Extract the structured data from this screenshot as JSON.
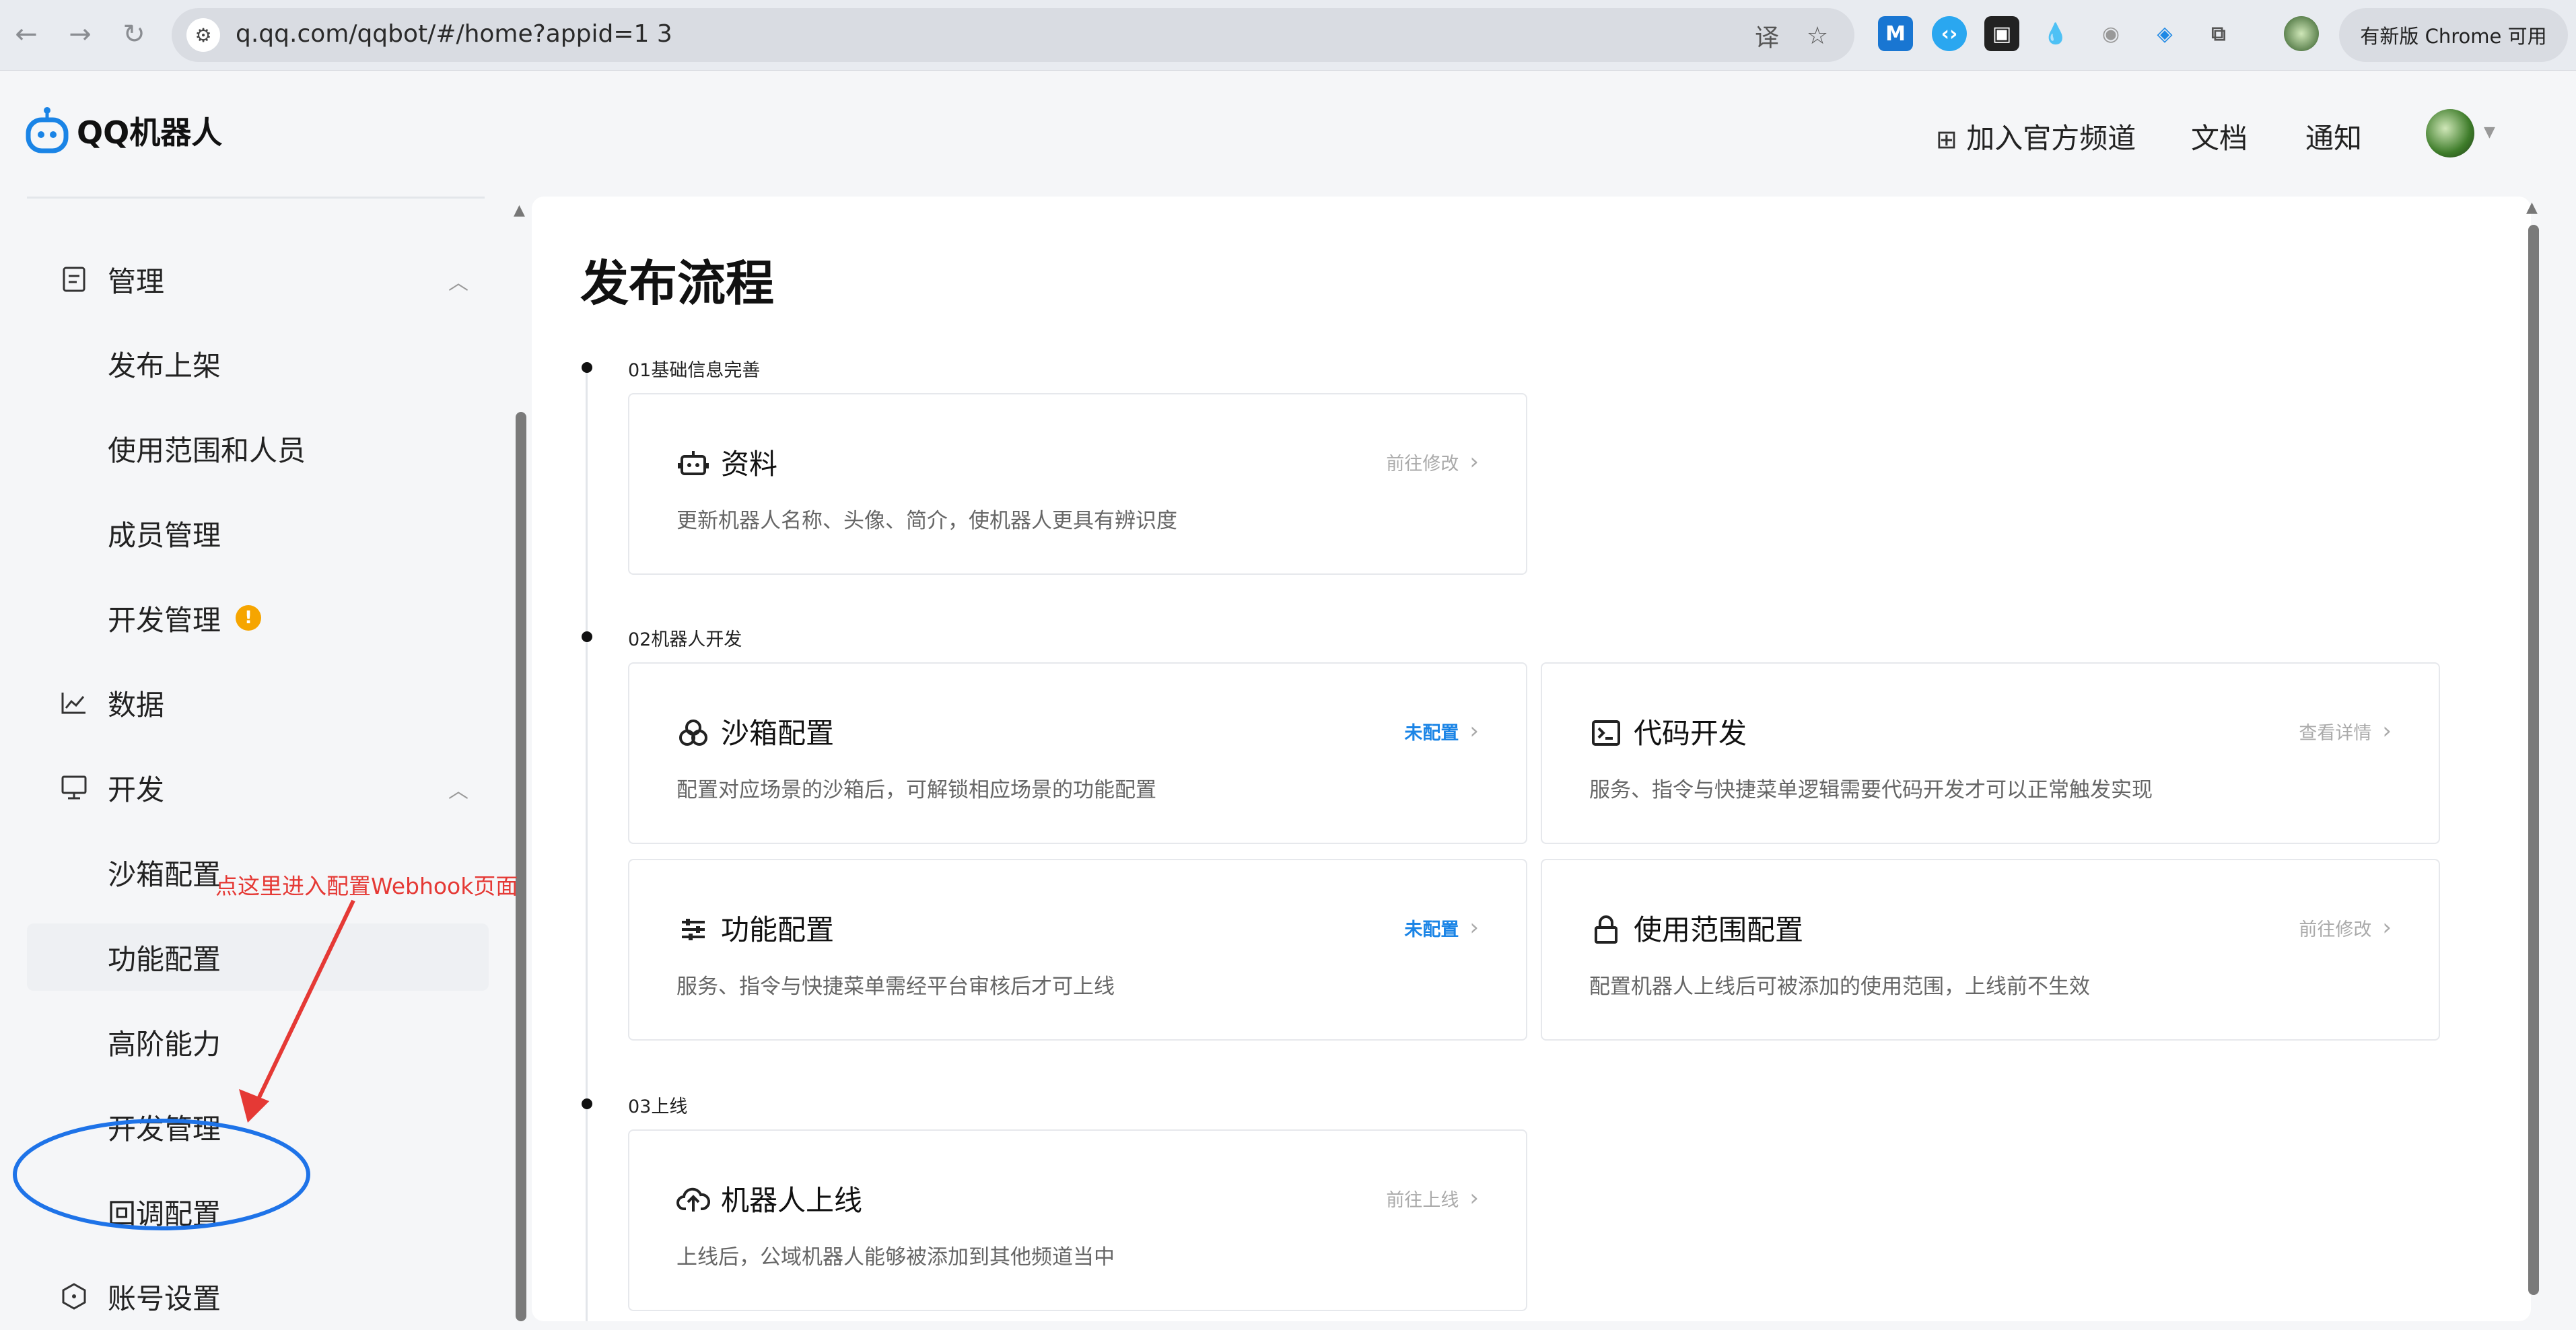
{
  "browser": {
    "url": "q.qq.com/qqbot/#/home?appid=1        3",
    "update_label": "有新版 Chrome 可用",
    "back_icon": "←",
    "forward_icon": "→",
    "reload_icon": "↻"
  },
  "header": {
    "logo_text": "QQ机器人",
    "links": [
      "加入官方频道",
      "文档",
      "通知"
    ]
  },
  "sidebar": {
    "items": [
      {
        "label": "管理",
        "type": "top",
        "icon": "document-icon",
        "expanded": true
      },
      {
        "label": "发布上架",
        "type": "sub"
      },
      {
        "label": "使用范围和人员",
        "type": "sub"
      },
      {
        "label": "成员管理",
        "type": "sub"
      },
      {
        "label": "开发管理",
        "type": "sub",
        "badge": "!"
      },
      {
        "label": "数据",
        "type": "top",
        "icon": "line-chart-icon"
      },
      {
        "label": "开发",
        "type": "top",
        "icon": "monitor-icon",
        "expanded": true
      },
      {
        "label": "沙箱配置",
        "type": "sub"
      },
      {
        "label": "功能配置",
        "type": "sub",
        "active": true
      },
      {
        "label": "高阶能力",
        "type": "sub"
      },
      {
        "label": "开发管理",
        "type": "sub"
      },
      {
        "label": "回调配置",
        "type": "sub"
      },
      {
        "label": "账号设置",
        "type": "top",
        "icon": "hexagon-icon"
      }
    ]
  },
  "annotation": {
    "text": "点这里进入配置Webhook页面"
  },
  "main": {
    "title": "发布流程",
    "sections": [
      {
        "label": "01基础信息完善",
        "cards": [
          {
            "title": "资料",
            "desc": "更新机器人名称、头像、简介，使机器人更具有辨识度",
            "action": "前往修改",
            "action_style": "gray",
            "icon": "robot-icon"
          }
        ]
      },
      {
        "label": "02机器人开发",
        "cards": [
          {
            "title": "沙箱配置",
            "desc": "配置对应场景的沙箱后，可解锁相应场景的功能配置",
            "action": "未配置",
            "action_style": "blue",
            "icon": "sandbox-icon"
          },
          {
            "title": "代码开发",
            "desc": "服务、指令与快捷菜单逻辑需要代码开发才可以正常触发实现",
            "action": "查看详情",
            "action_style": "gray",
            "icon": "terminal-icon"
          },
          {
            "title": "功能配置",
            "desc": "服务、指令与快捷菜单需经平台审核后才可上线",
            "action": "未配置",
            "action_style": "blue",
            "icon": "sliders-icon"
          },
          {
            "title": "使用范围配置",
            "desc": "配置机器人上线后可被添加的使用范围，上线前不生效",
            "action": "前往修改",
            "action_style": "gray",
            "icon": "lock-icon"
          }
        ]
      },
      {
        "label": "03上线",
        "cards": [
          {
            "title": "机器人上线",
            "desc": "上线后，公域机器人能够被添加到其他频道当中",
            "action": "前往上线",
            "action_style": "gray",
            "icon": "cloud-upload-icon"
          }
        ]
      }
    ]
  },
  "colors": {
    "accent_blue": "#1a84e6",
    "warning": "#f6a500",
    "annotation_red": "#e53935",
    "annotation_circle": "#1e73e8"
  }
}
